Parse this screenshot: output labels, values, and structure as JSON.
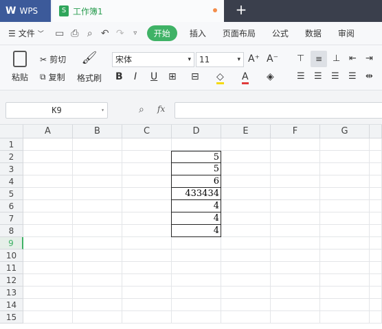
{
  "titlebar": {
    "app_tab": "WPS",
    "doc_tab": "工作簿1",
    "new_tab": "+"
  },
  "menubar": {
    "file": "文件",
    "items": [
      "开始",
      "插入",
      "页面布局",
      "公式",
      "数据",
      "审阅"
    ]
  },
  "ribbon": {
    "paste": "粘贴",
    "cut": "剪切",
    "copy": "复制",
    "format_painter": "格式刷",
    "font_name": "宋体",
    "font_size": "11",
    "grow_font": "A⁺",
    "shrink_font": "A⁻"
  },
  "formula": {
    "cell_ref": "K9",
    "fx": "fx",
    "value": ""
  },
  "columns": [
    "A",
    "B",
    "C",
    "D",
    "E",
    "F",
    "G"
  ],
  "rows": [
    "1",
    "2",
    "3",
    "4",
    "5",
    "6",
    "7",
    "8",
    "9",
    "10",
    "11",
    "12",
    "13",
    "14",
    "15"
  ],
  "active_row": "9",
  "colD_values": [
    "5",
    "5",
    "6",
    "433434",
    "4",
    "4",
    "4"
  ],
  "colors": {
    "accent": "#3fb266",
    "wps_blue": "#3c5a9a"
  }
}
